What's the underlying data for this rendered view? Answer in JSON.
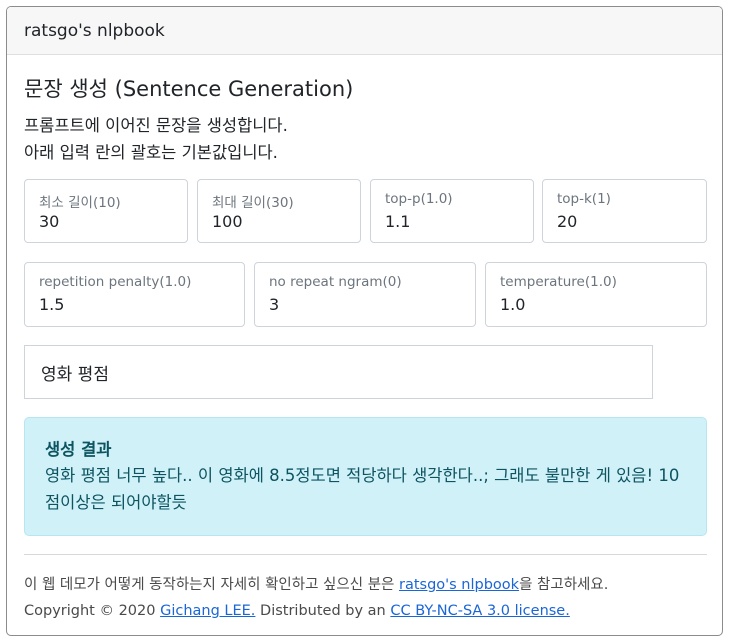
{
  "header": {
    "title": "ratsgo's nlpbook"
  },
  "main": {
    "title": "문장 생성 (Sentence Generation)",
    "description_line1": "프롬프트에 이어진 문장을 생성합니다.",
    "description_line2": "아래 입력 란의 괄호는 기본값입니다."
  },
  "params_row1": [
    {
      "label": "최소 길이(10)",
      "value": "30"
    },
    {
      "label": "최대 길이(30)",
      "value": "100"
    },
    {
      "label": "top-p(1.0)",
      "value": "1.1"
    },
    {
      "label": "top-k(1)",
      "value": "20"
    }
  ],
  "params_row2": [
    {
      "label": "repetition penalty(1.0)",
      "value": "1.5"
    },
    {
      "label": "no repeat ngram(0)",
      "value": "3"
    },
    {
      "label": "temperature(1.0)",
      "value": "1.0"
    }
  ],
  "prompt": {
    "value": "영화 평점"
  },
  "result": {
    "title": "생성 결과",
    "text": "영화 평점 너무 높다.. 이 영화에 8.5정도면 적당하다 생각한다..; 그래도 불만한 게 있음! 10점이상은 되어야할듯"
  },
  "footer": {
    "line1_prefix": "이 웹 데모가 어떻게 동작하는지 자세히 확인하고 싶으신 분은 ",
    "line1_link": "ratsgo's nlpbook",
    "line1_suffix": "을 참고하세요.",
    "line2_prefix": "Copyright © 2020 ",
    "line2_link_author": "Gichang LEE.",
    "line2_middle": " Distributed by an ",
    "line2_link_license": "CC BY-NC-SA 3.0 license."
  }
}
